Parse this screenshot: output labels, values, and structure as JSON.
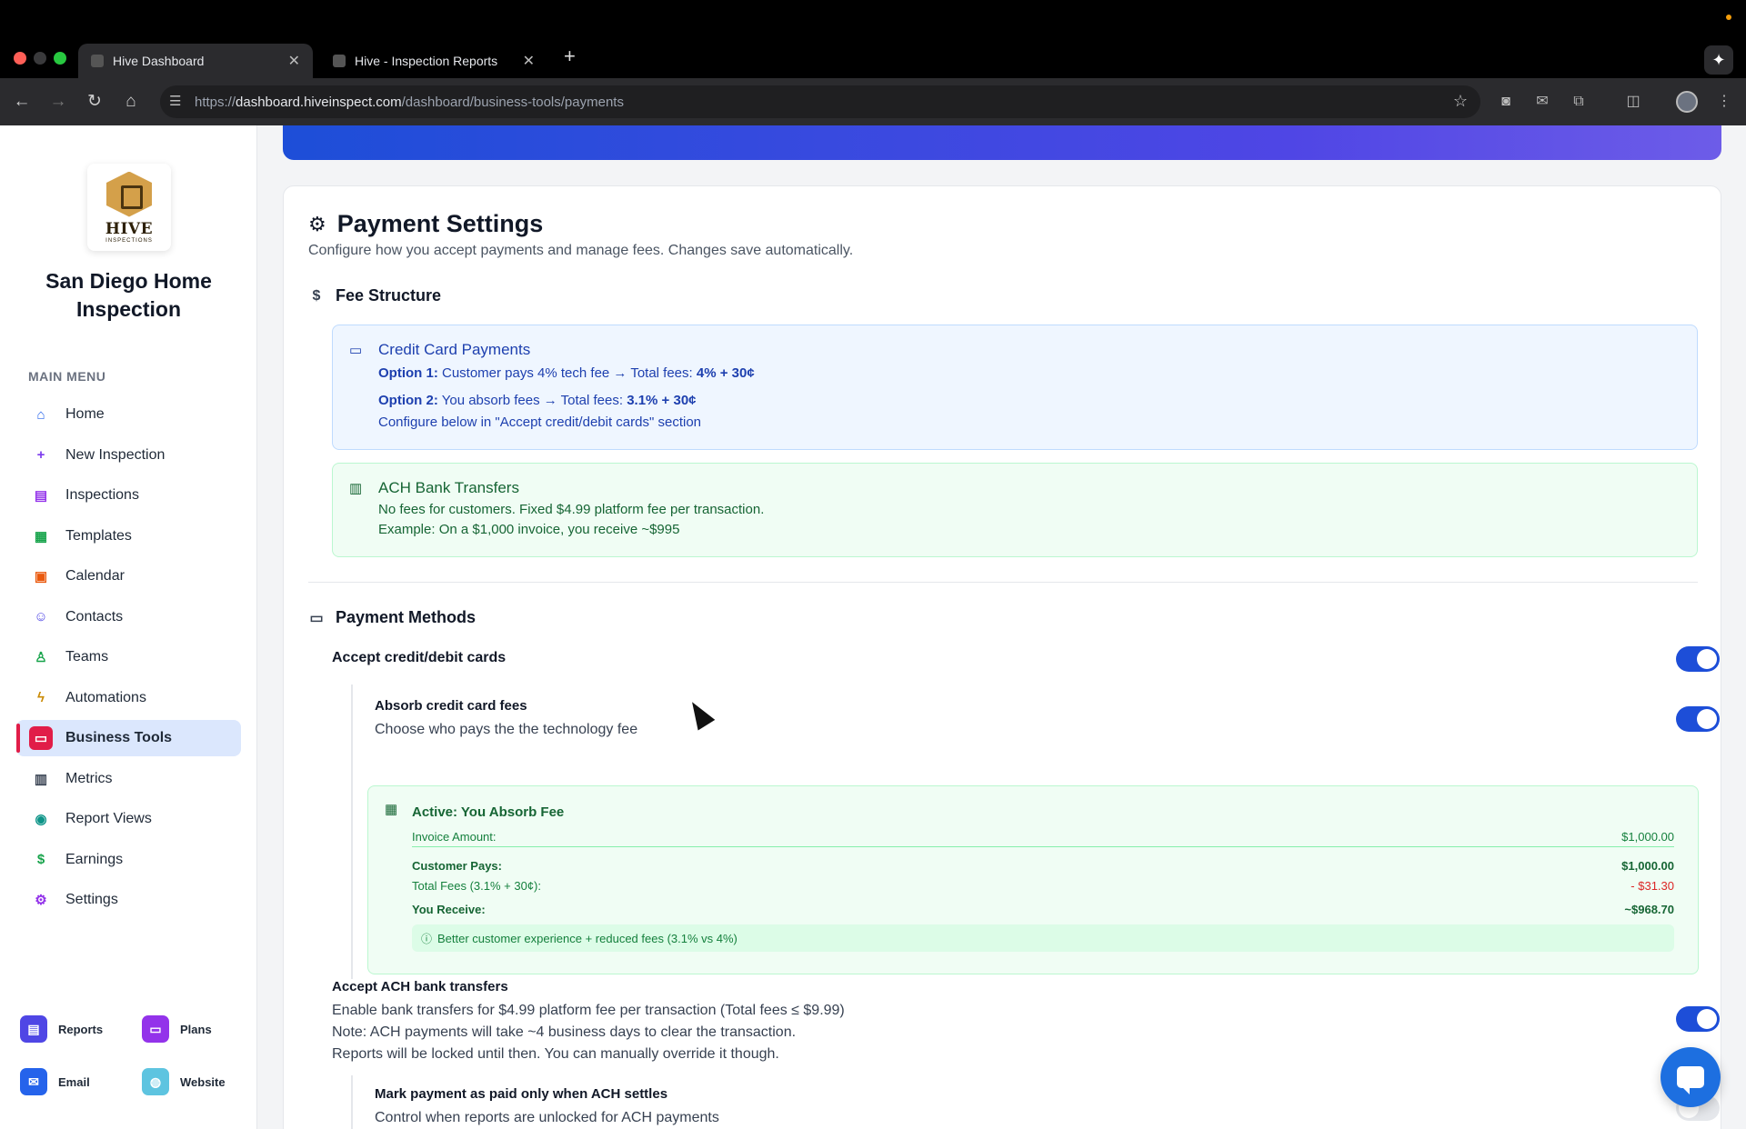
{
  "browser": {
    "tabs": [
      {
        "label": "Hive Dashboard",
        "active": true
      },
      {
        "label": "Hive - Inspection Reports",
        "active": false
      }
    ],
    "url": {
      "prefix": "https://",
      "host": "dashboard.hiveinspect.com",
      "path": "/dashboard/business-tools/payments"
    }
  },
  "sidebar": {
    "logo": {
      "brand": "HIVE",
      "sub": "INSPECTIONS"
    },
    "company_name": "San Diego Home Inspection",
    "menu_heading": "MAIN MENU",
    "items": [
      {
        "label": "Home",
        "icon": "home-icon",
        "color": "#2563eb",
        "glyph": "⌂"
      },
      {
        "label": "New Inspection",
        "icon": "plus-icon",
        "color": "#7c3aed",
        "glyph": "+"
      },
      {
        "label": "Inspections",
        "icon": "clipboard-icon",
        "color": "#9333ea",
        "glyph": "▤"
      },
      {
        "label": "Templates",
        "icon": "document-icon",
        "color": "#16a34a",
        "glyph": "▦"
      },
      {
        "label": "Calendar",
        "icon": "calendar-icon",
        "color": "#ea580c",
        "glyph": "▣"
      },
      {
        "label": "Contacts",
        "icon": "users-icon",
        "color": "#4f46e5",
        "glyph": "☺"
      },
      {
        "label": "Teams",
        "icon": "user-plus-icon",
        "color": "#16a34a",
        "glyph": "♙"
      },
      {
        "label": "Automations",
        "icon": "lightning-icon",
        "color": "#ca8a04",
        "glyph": "ϟ"
      },
      {
        "label": "Business Tools",
        "icon": "briefcase-icon",
        "color": "#ffffff",
        "glyph": "▭",
        "active": true
      },
      {
        "label": "Metrics",
        "icon": "bar-chart-icon",
        "color": "#374151",
        "glyph": "▥"
      },
      {
        "label": "Report Views",
        "icon": "eye-icon",
        "color": "#0d9488",
        "glyph": "◉"
      },
      {
        "label": "Earnings",
        "icon": "dollar-icon",
        "color": "#16a34a",
        "glyph": "$"
      },
      {
        "label": "Settings",
        "icon": "gear-icon",
        "color": "#9333ea",
        "glyph": "⚙"
      }
    ],
    "quick_links": [
      {
        "label": "Reports",
        "icon": "report-icon",
        "color": "#4f46e5",
        "glyph": "▤"
      },
      {
        "label": "Plans",
        "icon": "card-icon",
        "color": "#9333ea",
        "glyph": "▭"
      },
      {
        "label": "Email",
        "icon": "mail-icon",
        "color": "#2563eb",
        "glyph": "✉"
      },
      {
        "label": "Website",
        "icon": "globe-icon",
        "color": "#5ec4e0",
        "glyph": "◍"
      }
    ]
  },
  "main": {
    "title": "Payment Settings",
    "subtitle": "Configure how you accept payments and manage fees. Changes save automatically.",
    "fee_structure": {
      "heading": "Fee Structure",
      "credit_card": {
        "title": "Credit Card Payments",
        "option1_label": "Option 1:",
        "option1_text": " Customer pays 4% tech fee → Total fees: ",
        "option1_total": "4% + 30¢",
        "option2_label": "Option 2:",
        "option2_text": " You absorb fees → Total fees: ",
        "option2_total": "3.1% + 30¢",
        "configure_note": "Configure below in \"Accept credit/debit cards\" section"
      },
      "ach": {
        "title": "ACH Bank Transfers",
        "line1": "No fees for customers. Fixed $4.99 platform fee per transaction.",
        "line2": "Example: On a $1,000 invoice, you receive ~$995"
      }
    },
    "payment_methods": {
      "heading": "Payment Methods",
      "accept_cards": {
        "label": "Accept credit/debit cards",
        "enabled": true
      },
      "absorb_fees": {
        "label": "Absorb credit card fees",
        "description": "Choose who pays the the technology fee",
        "enabled": true
      },
      "absorb_summary": {
        "title": "Active: You Absorb Fee",
        "invoice_label": "Invoice Amount:",
        "invoice_value": "$1,000.00",
        "customer_pays_label": "Customer Pays:",
        "customer_pays_value": "$1,000.00",
        "total_fees_label": "Total Fees (3.1% + 30¢):",
        "total_fees_value": "- $31.30",
        "you_receive_label": "You Receive:",
        "you_receive_value": "~$968.70",
        "note": "Better customer experience + reduced fees (3.1% vs 4%)"
      },
      "accept_ach": {
        "label": "Accept ACH bank transfers",
        "line1": "Enable bank transfers for $4.99 platform fee per transaction (Total fees ≤ $9.99)",
        "line2": "Note: ACH payments will take ~4 business days to clear the transaction.",
        "line3": "Reports will be locked until then. You can manually override it though.",
        "enabled": true
      },
      "ach_settle": {
        "label": "Mark payment as paid only when ACH settles",
        "description": "Control when reports are unlocked for ACH payments",
        "enabled": false
      }
    }
  }
}
